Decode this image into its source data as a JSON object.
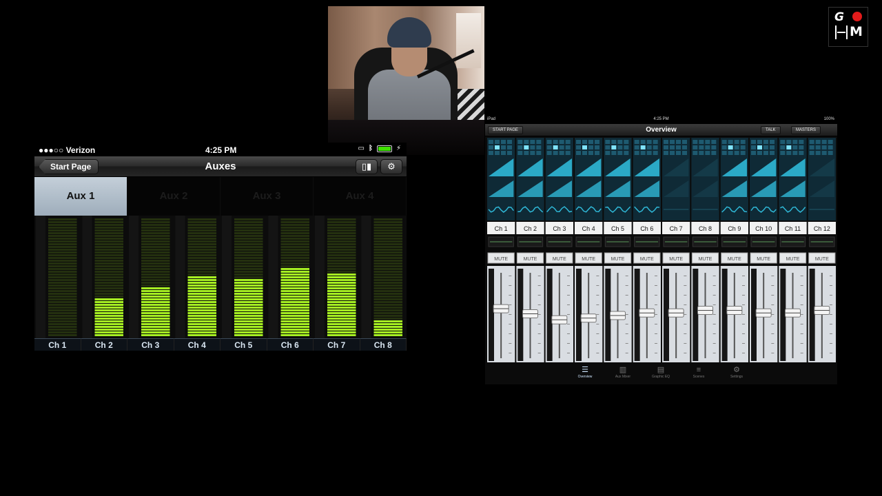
{
  "iphone": {
    "status": {
      "carrier": "●●●○○ Verizon",
      "time": "4:25 PM"
    },
    "nav": {
      "back_label": "Start Page",
      "title": "Auxes"
    },
    "tabs": [
      {
        "label": "Aux 1",
        "active": true
      },
      {
        "label": "Aux 2",
        "active": false
      },
      {
        "label": "Aux 3",
        "active": false
      },
      {
        "label": "Aux 4",
        "active": false
      }
    ],
    "channels": [
      {
        "label": "Ch 1",
        "level": 0.0
      },
      {
        "label": "Ch 2",
        "level": 0.32
      },
      {
        "label": "Ch 3",
        "level": 0.43
      },
      {
        "label": "Ch 4",
        "level": 0.51
      },
      {
        "label": "Ch 5",
        "level": 0.49
      },
      {
        "label": "Ch 6",
        "level": 0.59
      },
      {
        "label": "Ch 7",
        "level": 0.54
      },
      {
        "label": "Ch 8",
        "level": 0.14
      }
    ],
    "colors": {
      "meter_on": "#a6f022",
      "meter_off": "#2a3a10",
      "tab_active": "#b3c1cd"
    }
  },
  "ipad": {
    "status": {
      "device": "iPad",
      "time": "4:25 PM",
      "battery": "100%"
    },
    "buttons": {
      "start_page": "START PAGE",
      "talk": "TALK",
      "masters": "MASTERS"
    },
    "title": "Overview",
    "channels": [
      {
        "label": "Ch 1",
        "mute": "MUTE",
        "fader": 0.58,
        "active": true
      },
      {
        "label": "Ch 2",
        "mute": "MUTE",
        "fader": 0.52,
        "active": true
      },
      {
        "label": "Ch 3",
        "mute": "MUTE",
        "fader": 0.45,
        "active": true
      },
      {
        "label": "Ch 4",
        "mute": "MUTE",
        "fader": 0.47,
        "active": true
      },
      {
        "label": "Ch 5",
        "mute": "MUTE",
        "fader": 0.5,
        "active": true
      },
      {
        "label": "Ch 6",
        "mute": "MUTE",
        "fader": 0.53,
        "active": true
      },
      {
        "label": "Ch 7",
        "mute": "MUTE",
        "fader": 0.53,
        "active": false
      },
      {
        "label": "Ch 8",
        "mute": "MUTE",
        "fader": 0.56,
        "active": false
      },
      {
        "label": "Ch 9",
        "mute": "MUTE",
        "fader": 0.56,
        "active": true
      },
      {
        "label": "Ch 10",
        "mute": "MUTE",
        "fader": 0.53,
        "active": true
      },
      {
        "label": "Ch 11",
        "mute": "MUTE",
        "fader": 0.53,
        "active": true
      },
      {
        "label": "Ch 12",
        "mute": "MUTE",
        "fader": 0.56,
        "active": false
      }
    ],
    "tabs": [
      {
        "label": "Overview",
        "icon": "overview-icon",
        "active": true
      },
      {
        "label": "Aux Mixer",
        "icon": "aux-mixer-icon",
        "active": false
      },
      {
        "label": "Graphic EQ",
        "icon": "graphic-eq-icon",
        "active": false
      },
      {
        "label": "Scenes",
        "icon": "scenes-icon",
        "active": false
      },
      {
        "label": "Settings",
        "icon": "settings-icon",
        "active": false
      }
    ],
    "colors": {
      "strip_active": "#2fb7d6",
      "strip_dim": "#1a4a5a",
      "fader_bg": "#d9dde2"
    }
  },
  "logo": {
    "letter_g": "G",
    "letter_m": "M"
  }
}
